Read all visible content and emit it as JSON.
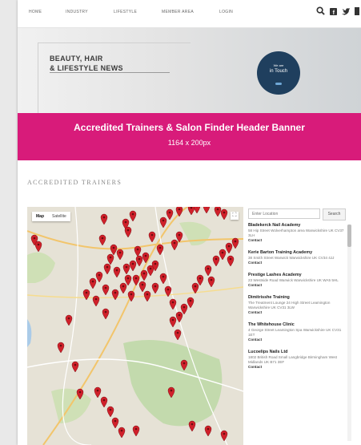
{
  "nav": {
    "items": [
      "HOME",
      "INDUSTRY",
      "LIFESTYLE",
      "MEMBER AREA",
      "LOGIN"
    ],
    "icons": [
      "search-icon",
      "facebook-icon",
      "twitter-icon",
      "menu-icon"
    ]
  },
  "hero": {
    "title": "BEAUTY, HAIR\n& LIFESTYLE NEWS",
    "badge_small": "We are",
    "badge_main": "in Touch"
  },
  "banner": {
    "title": "Accredited Trainers & Salon Finder Header Banner",
    "size": "1164 x 200px",
    "color": "#d81b7a"
  },
  "section": {
    "title": "ACCREDITED TRAINERS"
  },
  "map": {
    "tabs": [
      "Map",
      "Satellite"
    ],
    "active_tab": "Map",
    "fullscreen_glyph": "⛶"
  },
  "finder": {
    "search_placeholder": "Enter Location",
    "search_button": "Search",
    "entries": [
      {
        "name": "Bladekerck Nail Academy",
        "address": "58 Hip Street Wolverhampton area Warwickshire UK CV37 3LH",
        "contact": "Contact"
      },
      {
        "name": "Kerie Barton Training Academy",
        "address": "38 Smith Street Warwick Warwickshire UK CV34 4JJ",
        "contact": "Contact"
      },
      {
        "name": "Prestige Lashes Academy",
        "address": "23 Westside Road Warwick Warwickshire UK WA5 5HL",
        "contact": "Contact"
      },
      {
        "name": "Dimitrisshe Training",
        "address": "The Treatment Lounge 24 High Street Leamington Warwickshire UK CV31 3LW",
        "contact": "Contact"
      },
      {
        "name": "The Whitehouse Clinic",
        "address": "4 George Street Leamington Spa Warwickshire UK CV31 1ET",
        "contact": "Contact"
      },
      {
        "name": "Lucoelips Nails Ltd",
        "address": "1802 British Road Small Langbridge Birmingham West Midlands UK B71 3EF",
        "contact": "Contact"
      }
    ]
  }
}
